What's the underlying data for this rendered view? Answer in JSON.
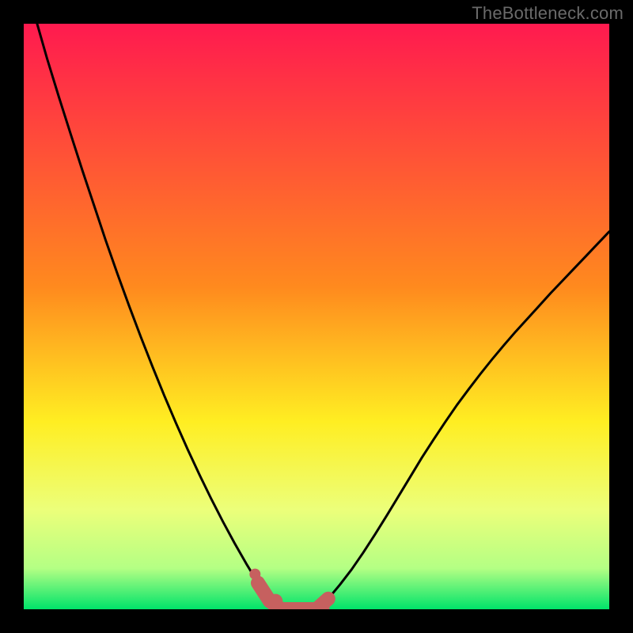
{
  "watermark": "TheBottleneck.com",
  "colors": {
    "frame": "#000000",
    "watermark": "#6a6a6a",
    "curve": "#000000",
    "highlight": "#c6605f",
    "grad_top": "#ff1a4f",
    "grad_mid1": "#ff8a1e",
    "grad_mid2": "#ffee22",
    "grad_mid3": "#ecff7a",
    "grad_mid4": "#b4ff84",
    "grad_bottom": "#00e36a"
  },
  "chart_data": {
    "type": "line",
    "title": "",
    "xlabel": "",
    "ylabel": "",
    "xlim": [
      0,
      1
    ],
    "ylim": [
      0,
      1
    ],
    "x": [
      0.0,
      0.02,
      0.04,
      0.06,
      0.08,
      0.1,
      0.12,
      0.14,
      0.16,
      0.18,
      0.2,
      0.22,
      0.24,
      0.26,
      0.28,
      0.3,
      0.32,
      0.34,
      0.36,
      0.38,
      0.4,
      0.42,
      0.44,
      0.46,
      0.48,
      0.5,
      0.52,
      0.54,
      0.56,
      0.58,
      0.6,
      0.62,
      0.64,
      0.66,
      0.68,
      0.7,
      0.72,
      0.74,
      0.76,
      0.78,
      0.8,
      0.82,
      0.84,
      0.86,
      0.88,
      0.9,
      0.92,
      0.94,
      0.96,
      0.98,
      1.0
    ],
    "values": [
      1.08,
      1.01,
      0.94,
      0.875,
      0.812,
      0.75,
      0.69,
      0.63,
      0.573,
      0.518,
      0.465,
      0.414,
      0.365,
      0.318,
      0.273,
      0.23,
      0.189,
      0.15,
      0.113,
      0.078,
      0.045,
      0.014,
      0.0,
      0.0,
      0.0,
      0.0,
      0.018,
      0.042,
      0.068,
      0.097,
      0.128,
      0.16,
      0.193,
      0.226,
      0.259,
      0.29,
      0.32,
      0.349,
      0.376,
      0.402,
      0.427,
      0.451,
      0.474,
      0.496,
      0.518,
      0.54,
      0.561,
      0.582,
      0.603,
      0.624,
      0.645
    ],
    "highlight_x_range": [
      0.4,
      0.52
    ],
    "highlight_points_x": [
      0.395,
      0.43,
      0.45,
      0.47,
      0.49,
      0.51
    ],
    "highlight_points_y": [
      0.06,
      0.014,
      0.0,
      0.0,
      0.0,
      0.002
    ]
  }
}
